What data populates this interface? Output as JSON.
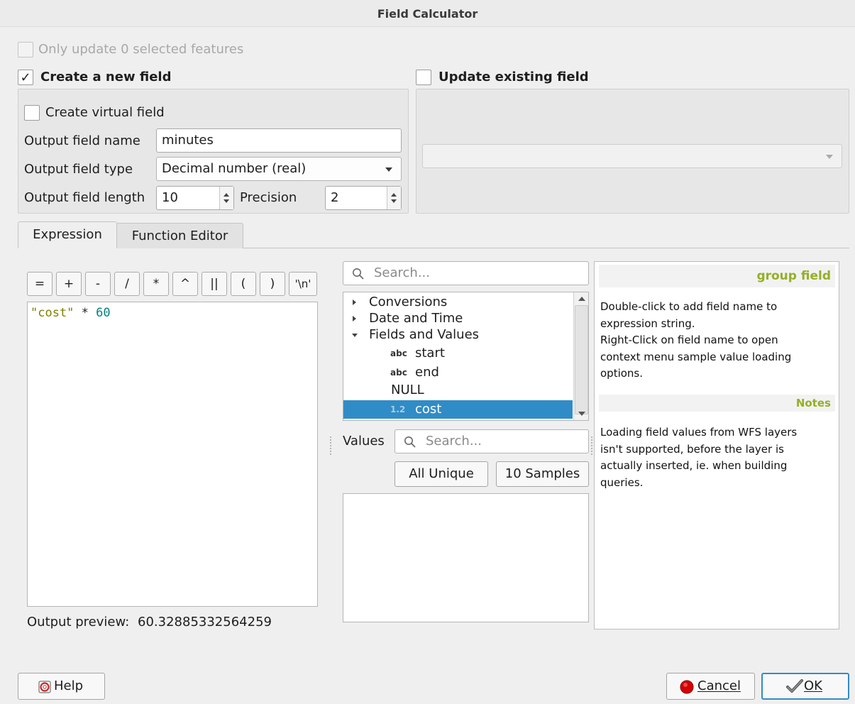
{
  "window": {
    "title": "Field Calculator"
  },
  "top": {
    "only_selected_label": "Only update 0 selected features",
    "create_new_label": "Create a new field",
    "create_new_checked": true,
    "update_existing_label": "Update existing field",
    "update_existing_checked": false
  },
  "new_field": {
    "virtual_label": "Create virtual field",
    "name_label": "Output field name",
    "name_value": "minutes",
    "type_label": "Output field type",
    "type_value": "Decimal number (real)",
    "length_label": "Output field length",
    "length_value": "10",
    "precision_label": "Precision",
    "precision_value": "2"
  },
  "tabs": [
    {
      "label": "Expression",
      "active": true
    },
    {
      "label": "Function Editor",
      "active": false
    }
  ],
  "operators": [
    "=",
    "+",
    "-",
    "/",
    "*",
    "^",
    "||",
    "(",
    ")",
    "'\\n'"
  ],
  "expression": {
    "field_token": "\"cost\"",
    "operator_token": "*",
    "number_token": "60",
    "preview_label": "Output preview:",
    "preview_value": "60.32885332564259"
  },
  "function_list": {
    "search_placeholder": "Search...",
    "items": [
      {
        "type": "group",
        "label": "Conversions",
        "expanded": false
      },
      {
        "type": "group",
        "label": "Date and Time",
        "expanded": false
      },
      {
        "type": "group",
        "label": "Fields and Values",
        "expanded": true
      },
      {
        "type": "field",
        "prefix": "abc",
        "label": "start"
      },
      {
        "type": "field",
        "prefix": "abc",
        "label": "end"
      },
      {
        "type": "value",
        "label": "NULL"
      },
      {
        "type": "field",
        "prefix": "1.2",
        "label": "cost",
        "selected": true
      }
    ]
  },
  "values": {
    "label": "Values",
    "search_placeholder": "Search...",
    "all_unique_label": "All Unique",
    "samples_label": "10 Samples"
  },
  "help_panel": {
    "heading": "group field",
    "body_lines": [
      "Double-click to add field name to",
      "expression string.",
      "Right-Click on field name to open",
      "context menu sample value loading",
      "options."
    ],
    "notes_heading": "Notes",
    "notes_lines": [
      "Loading field values from WFS layers",
      "isn't supported, before the layer is",
      "actually inserted, ie. when building",
      "queries."
    ]
  },
  "footer": {
    "help_label": "Help",
    "cancel_label": "Cancel",
    "ok_label": "OK"
  },
  "colors": {
    "accent": "#308cc6",
    "heading_green": "#93b023",
    "expr_string": "#808000",
    "expr_number": "#008080"
  }
}
